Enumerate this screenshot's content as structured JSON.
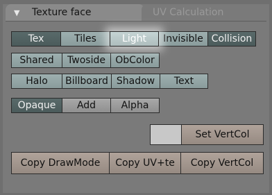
{
  "tabs": {
    "active_label": "Texture face",
    "inactive_label": "UV Calculation",
    "toggle_icon": "triangle-down"
  },
  "row1": [
    {
      "label": "Tex",
      "state": "on"
    },
    {
      "label": "Tiles",
      "state": "off"
    },
    {
      "label": "Light",
      "state": "highlighted"
    },
    {
      "label": "Invisible",
      "state": "off"
    },
    {
      "label": "Collision",
      "state": "on"
    }
  ],
  "row2": [
    {
      "label": "Shared"
    },
    {
      "label": "Twoside"
    },
    {
      "label": "ObColor"
    }
  ],
  "row3": [
    {
      "label": "Halo"
    },
    {
      "label": "Billboard"
    },
    {
      "label": "Shadow"
    },
    {
      "label": "Text"
    }
  ],
  "row4": [
    {
      "label": "Opaque",
      "state": "on"
    },
    {
      "label": "Add",
      "state": "off"
    },
    {
      "label": "Alpha",
      "state": "off"
    }
  ],
  "vertcol": {
    "swatch_color": "#c8c8c8",
    "set_label": "Set VertCol"
  },
  "copy": {
    "drawmode_label": "Copy DrawMode",
    "uv_label": "Copy UV+te",
    "vertcol_label": "Copy VertCol"
  },
  "colors": {
    "panel": "#7a7a7a",
    "teal_button": "#9eb0b0",
    "toggled_button": "#596a6a",
    "copy_button": "#b0a39a"
  }
}
